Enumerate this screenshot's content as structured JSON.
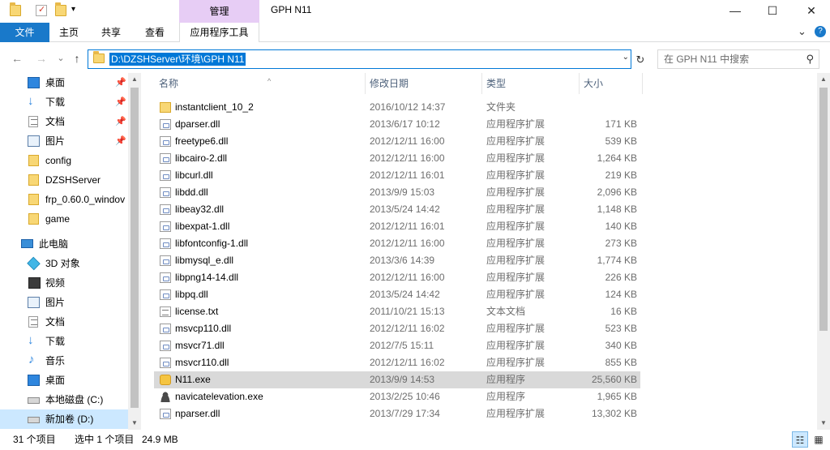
{
  "titlebar": {
    "manage_tab": "管理",
    "window_title": "GPH N11",
    "minimize_glyph": "—",
    "maximize_glyph": "☐",
    "close_glyph": "✕",
    "qa_dropdown_glyph": "▾"
  },
  "ribbon": {
    "tabs": [
      "文件",
      "主页",
      "共享",
      "查看",
      "应用程序工具"
    ],
    "expand_glyph": "⌄",
    "help_glyph": "?",
    "file_tab_color": "#1979ca",
    "manage_tab_color": "#e7cdf5"
  },
  "address": {
    "back_glyph": "←",
    "forward_glyph": "→",
    "recent_glyph": "⌄",
    "up_glyph": "↑",
    "path": "D:\\DZSHServer\\环境\\GPH N11",
    "dropdown_glyph": "⌄",
    "refresh_glyph": "↻",
    "accent": "#0078d7"
  },
  "search": {
    "placeholder": "在 GPH N11 中搜索",
    "icon_glyph": "⚲"
  },
  "navpane": {
    "pin_glyph": "📌",
    "quick_access": [
      {
        "label": "桌面",
        "icon": "desktop-icon",
        "pinned": true
      },
      {
        "label": "下载",
        "icon": "download-icon",
        "pinned": true
      },
      {
        "label": "文档",
        "icon": "document-icon",
        "pinned": true
      },
      {
        "label": "图片",
        "icon": "picture-icon",
        "pinned": true
      },
      {
        "label": "config",
        "icon": "folder-icon",
        "pinned": false
      },
      {
        "label": "DZSHServer",
        "icon": "folder-icon",
        "pinned": false
      },
      {
        "label": "frp_0.60.0_windov",
        "icon": "folder-icon",
        "pinned": false
      },
      {
        "label": "game",
        "icon": "folder-icon",
        "pinned": false
      }
    ],
    "this_pc_label": "此电脑",
    "this_pc_items": [
      {
        "label": "3D 对象",
        "icon": "3d-objects-icon"
      },
      {
        "label": "视频",
        "icon": "video-icon"
      },
      {
        "label": "图片",
        "icon": "picture-icon"
      },
      {
        "label": "文档",
        "icon": "document-icon"
      },
      {
        "label": "下载",
        "icon": "download-icon"
      },
      {
        "label": "音乐",
        "icon": "music-icon"
      },
      {
        "label": "桌面",
        "icon": "desktop-icon"
      },
      {
        "label": "本地磁盘 (C:)",
        "icon": "drive-icon"
      },
      {
        "label": "新加卷 (D:)",
        "icon": "drive-icon",
        "selected": true
      }
    ]
  },
  "columns": {
    "name": "名称",
    "date": "修改日期",
    "type": "类型",
    "size": "大小",
    "sort_glyph": "^"
  },
  "files": [
    {
      "name": "instantclient_10_2",
      "date": "2016/10/12 14:37",
      "type": "文件夹",
      "size": "",
      "icon": "folder"
    },
    {
      "name": "dparser.dll",
      "date": "2013/6/17 10:12",
      "type": "应用程序扩展",
      "size": "171 KB",
      "icon": "dll"
    },
    {
      "name": "freetype6.dll",
      "date": "2012/12/11 16:00",
      "type": "应用程序扩展",
      "size": "539 KB",
      "icon": "dll"
    },
    {
      "name": "libcairo-2.dll",
      "date": "2012/12/11 16:00",
      "type": "应用程序扩展",
      "size": "1,264 KB",
      "icon": "dll"
    },
    {
      "name": "libcurl.dll",
      "date": "2012/12/11 16:01",
      "type": "应用程序扩展",
      "size": "219 KB",
      "icon": "dll"
    },
    {
      "name": "libdd.dll",
      "date": "2013/9/9 15:03",
      "type": "应用程序扩展",
      "size": "2,096 KB",
      "icon": "dll"
    },
    {
      "name": "libeay32.dll",
      "date": "2013/5/24 14:42",
      "type": "应用程序扩展",
      "size": "1,148 KB",
      "icon": "dll"
    },
    {
      "name": "libexpat-1.dll",
      "date": "2012/12/11 16:01",
      "type": "应用程序扩展",
      "size": "140 KB",
      "icon": "dll"
    },
    {
      "name": "libfontconfig-1.dll",
      "date": "2012/12/11 16:00",
      "type": "应用程序扩展",
      "size": "273 KB",
      "icon": "dll"
    },
    {
      "name": "libmysql_e.dll",
      "date": "2013/3/6 14:39",
      "type": "应用程序扩展",
      "size": "1,774 KB",
      "icon": "dll"
    },
    {
      "name": "libpng14-14.dll",
      "date": "2012/12/11 16:00",
      "type": "应用程序扩展",
      "size": "226 KB",
      "icon": "dll"
    },
    {
      "name": "libpq.dll",
      "date": "2013/5/24 14:42",
      "type": "应用程序扩展",
      "size": "124 KB",
      "icon": "dll"
    },
    {
      "name": "license.txt",
      "date": "2011/10/21 15:13",
      "type": "文本文档",
      "size": "16 KB",
      "icon": "txt"
    },
    {
      "name": "msvcp110.dll",
      "date": "2012/12/11 16:02",
      "type": "应用程序扩展",
      "size": "523 KB",
      "icon": "dll"
    },
    {
      "name": "msvcr71.dll",
      "date": "2012/7/5 15:11",
      "type": "应用程序扩展",
      "size": "340 KB",
      "icon": "dll"
    },
    {
      "name": "msvcr110.dll",
      "date": "2012/12/11 16:02",
      "type": "应用程序扩展",
      "size": "855 KB",
      "icon": "dll"
    },
    {
      "name": "N11.exe",
      "date": "2013/9/9 14:53",
      "type": "应用程序",
      "size": "25,560 KB",
      "icon": "exe",
      "selected": true
    },
    {
      "name": "navicatelevation.exe",
      "date": "2013/2/25 10:46",
      "type": "应用程序",
      "size": "1,965 KB",
      "icon": "user"
    },
    {
      "name": "nparser.dll",
      "date": "2013/7/29 17:34",
      "type": "应用程序扩展",
      "size": "13,302 KB",
      "icon": "dll"
    }
  ],
  "status": {
    "count": "31 个项目",
    "selected": "选中 1 个项目",
    "size": "24.9 MB",
    "details_view_glyph": "☷",
    "icons_view_glyph": "▦"
  },
  "scroll": {
    "up_glyph": "▲",
    "down_glyph": "▼"
  }
}
